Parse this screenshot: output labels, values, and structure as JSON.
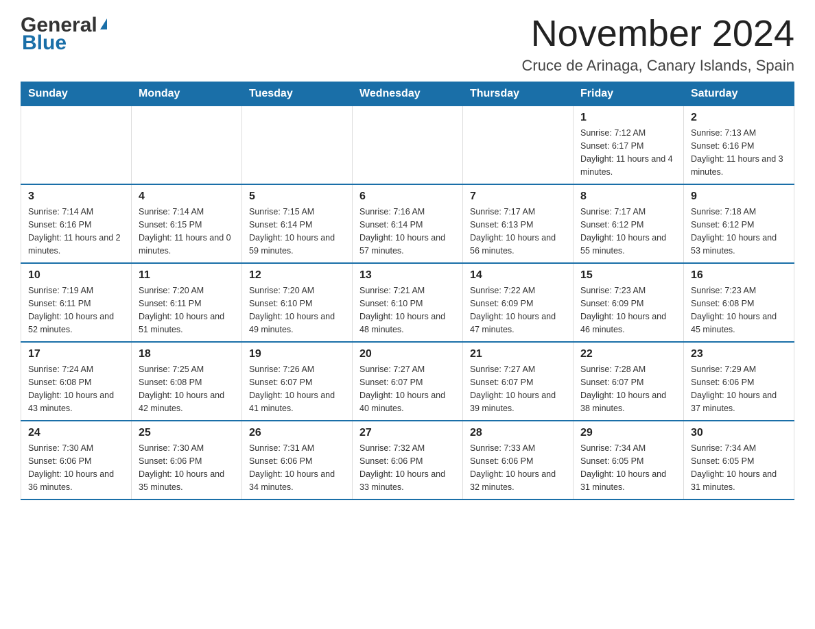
{
  "logo": {
    "general": "General",
    "blue": "Blue",
    "triangle_color": "#1a6fa8"
  },
  "title": {
    "month_year": "November 2024",
    "location": "Cruce de Arinaga, Canary Islands, Spain"
  },
  "header_days": [
    "Sunday",
    "Monday",
    "Tuesday",
    "Wednesday",
    "Thursday",
    "Friday",
    "Saturday"
  ],
  "weeks": [
    [
      {
        "day": "",
        "info": ""
      },
      {
        "day": "",
        "info": ""
      },
      {
        "day": "",
        "info": ""
      },
      {
        "day": "",
        "info": ""
      },
      {
        "day": "",
        "info": ""
      },
      {
        "day": "1",
        "info": "Sunrise: 7:12 AM\nSunset: 6:17 PM\nDaylight: 11 hours and 4 minutes."
      },
      {
        "day": "2",
        "info": "Sunrise: 7:13 AM\nSunset: 6:16 PM\nDaylight: 11 hours and 3 minutes."
      }
    ],
    [
      {
        "day": "3",
        "info": "Sunrise: 7:14 AM\nSunset: 6:16 PM\nDaylight: 11 hours and 2 minutes."
      },
      {
        "day": "4",
        "info": "Sunrise: 7:14 AM\nSunset: 6:15 PM\nDaylight: 11 hours and 0 minutes."
      },
      {
        "day": "5",
        "info": "Sunrise: 7:15 AM\nSunset: 6:14 PM\nDaylight: 10 hours and 59 minutes."
      },
      {
        "day": "6",
        "info": "Sunrise: 7:16 AM\nSunset: 6:14 PM\nDaylight: 10 hours and 57 minutes."
      },
      {
        "day": "7",
        "info": "Sunrise: 7:17 AM\nSunset: 6:13 PM\nDaylight: 10 hours and 56 minutes."
      },
      {
        "day": "8",
        "info": "Sunrise: 7:17 AM\nSunset: 6:12 PM\nDaylight: 10 hours and 55 minutes."
      },
      {
        "day": "9",
        "info": "Sunrise: 7:18 AM\nSunset: 6:12 PM\nDaylight: 10 hours and 53 minutes."
      }
    ],
    [
      {
        "day": "10",
        "info": "Sunrise: 7:19 AM\nSunset: 6:11 PM\nDaylight: 10 hours and 52 minutes."
      },
      {
        "day": "11",
        "info": "Sunrise: 7:20 AM\nSunset: 6:11 PM\nDaylight: 10 hours and 51 minutes."
      },
      {
        "day": "12",
        "info": "Sunrise: 7:20 AM\nSunset: 6:10 PM\nDaylight: 10 hours and 49 minutes."
      },
      {
        "day": "13",
        "info": "Sunrise: 7:21 AM\nSunset: 6:10 PM\nDaylight: 10 hours and 48 minutes."
      },
      {
        "day": "14",
        "info": "Sunrise: 7:22 AM\nSunset: 6:09 PM\nDaylight: 10 hours and 47 minutes."
      },
      {
        "day": "15",
        "info": "Sunrise: 7:23 AM\nSunset: 6:09 PM\nDaylight: 10 hours and 46 minutes."
      },
      {
        "day": "16",
        "info": "Sunrise: 7:23 AM\nSunset: 6:08 PM\nDaylight: 10 hours and 45 minutes."
      }
    ],
    [
      {
        "day": "17",
        "info": "Sunrise: 7:24 AM\nSunset: 6:08 PM\nDaylight: 10 hours and 43 minutes."
      },
      {
        "day": "18",
        "info": "Sunrise: 7:25 AM\nSunset: 6:08 PM\nDaylight: 10 hours and 42 minutes."
      },
      {
        "day": "19",
        "info": "Sunrise: 7:26 AM\nSunset: 6:07 PM\nDaylight: 10 hours and 41 minutes."
      },
      {
        "day": "20",
        "info": "Sunrise: 7:27 AM\nSunset: 6:07 PM\nDaylight: 10 hours and 40 minutes."
      },
      {
        "day": "21",
        "info": "Sunrise: 7:27 AM\nSunset: 6:07 PM\nDaylight: 10 hours and 39 minutes."
      },
      {
        "day": "22",
        "info": "Sunrise: 7:28 AM\nSunset: 6:07 PM\nDaylight: 10 hours and 38 minutes."
      },
      {
        "day": "23",
        "info": "Sunrise: 7:29 AM\nSunset: 6:06 PM\nDaylight: 10 hours and 37 minutes."
      }
    ],
    [
      {
        "day": "24",
        "info": "Sunrise: 7:30 AM\nSunset: 6:06 PM\nDaylight: 10 hours and 36 minutes."
      },
      {
        "day": "25",
        "info": "Sunrise: 7:30 AM\nSunset: 6:06 PM\nDaylight: 10 hours and 35 minutes."
      },
      {
        "day": "26",
        "info": "Sunrise: 7:31 AM\nSunset: 6:06 PM\nDaylight: 10 hours and 34 minutes."
      },
      {
        "day": "27",
        "info": "Sunrise: 7:32 AM\nSunset: 6:06 PM\nDaylight: 10 hours and 33 minutes."
      },
      {
        "day": "28",
        "info": "Sunrise: 7:33 AM\nSunset: 6:06 PM\nDaylight: 10 hours and 32 minutes."
      },
      {
        "day": "29",
        "info": "Sunrise: 7:34 AM\nSunset: 6:05 PM\nDaylight: 10 hours and 31 minutes."
      },
      {
        "day": "30",
        "info": "Sunrise: 7:34 AM\nSunset: 6:05 PM\nDaylight: 10 hours and 31 minutes."
      }
    ]
  ]
}
